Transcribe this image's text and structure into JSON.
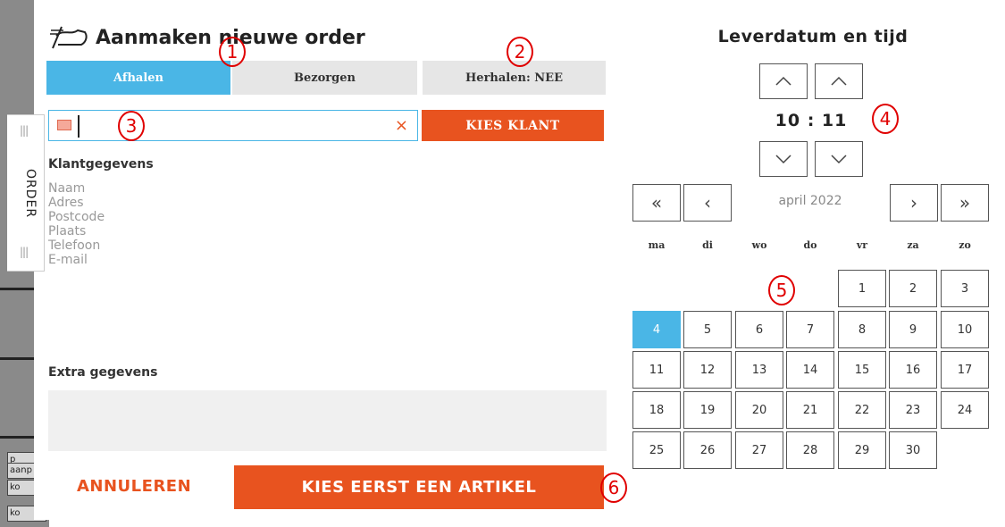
{
  "background": {
    "cells": [
      "p",
      "aanp",
      "ko",
      "ko"
    ]
  },
  "side_tab": {
    "label": "ORDER",
    "grip": "|||"
  },
  "header": {
    "title": "Aanmaken nieuwe order",
    "icon": "flag-icon"
  },
  "tabs": [
    {
      "label": "Afhalen",
      "active": true
    },
    {
      "label": "Bezorgen",
      "active": false
    },
    {
      "label": "Herhalen: NEE",
      "active": false
    }
  ],
  "search": {
    "value": "",
    "placeholder": "",
    "clear_glyph": "×"
  },
  "kies_klant_label": "KIES KLANT",
  "klantgegevens": {
    "heading": "Klantgegevens",
    "fields": [
      "Naam",
      "Adres",
      "Postcode",
      "Plaats",
      "Telefoon",
      "E-mail"
    ]
  },
  "extra": {
    "heading": "Extra gegevens"
  },
  "footer": {
    "cancel_label": "ANNULEREN",
    "confirm_label": "KIES EERST EEN ARTIKEL"
  },
  "datetime": {
    "title": "Leverdatum en tijd",
    "hour": "10",
    "separator": ":",
    "minute": "11",
    "time_display": "10 : 11"
  },
  "calendar": {
    "month_label": "april 2022",
    "nav": {
      "prev_year": "«",
      "prev_month": "‹",
      "next_month": "›",
      "next_year": "»"
    },
    "weekdays": [
      "ma",
      "di",
      "wo",
      "do",
      "vr",
      "za",
      "zo"
    ],
    "days": [
      "1",
      "2",
      "3",
      "4",
      "5",
      "6",
      "7",
      "8",
      "9",
      "10",
      "11",
      "12",
      "13",
      "14",
      "15",
      "16",
      "17",
      "18",
      "19",
      "20",
      "21",
      "22",
      "23",
      "24",
      "25",
      "26",
      "27",
      "28",
      "29",
      "30"
    ],
    "first_weekday_index": 4,
    "selected_day": "4"
  },
  "annotations": [
    "1",
    "2",
    "3",
    "4",
    "5",
    "6"
  ],
  "colors": {
    "accent_blue": "#4ab6e6",
    "accent_orange": "#e8531f",
    "annotation_red": "#e00000"
  }
}
